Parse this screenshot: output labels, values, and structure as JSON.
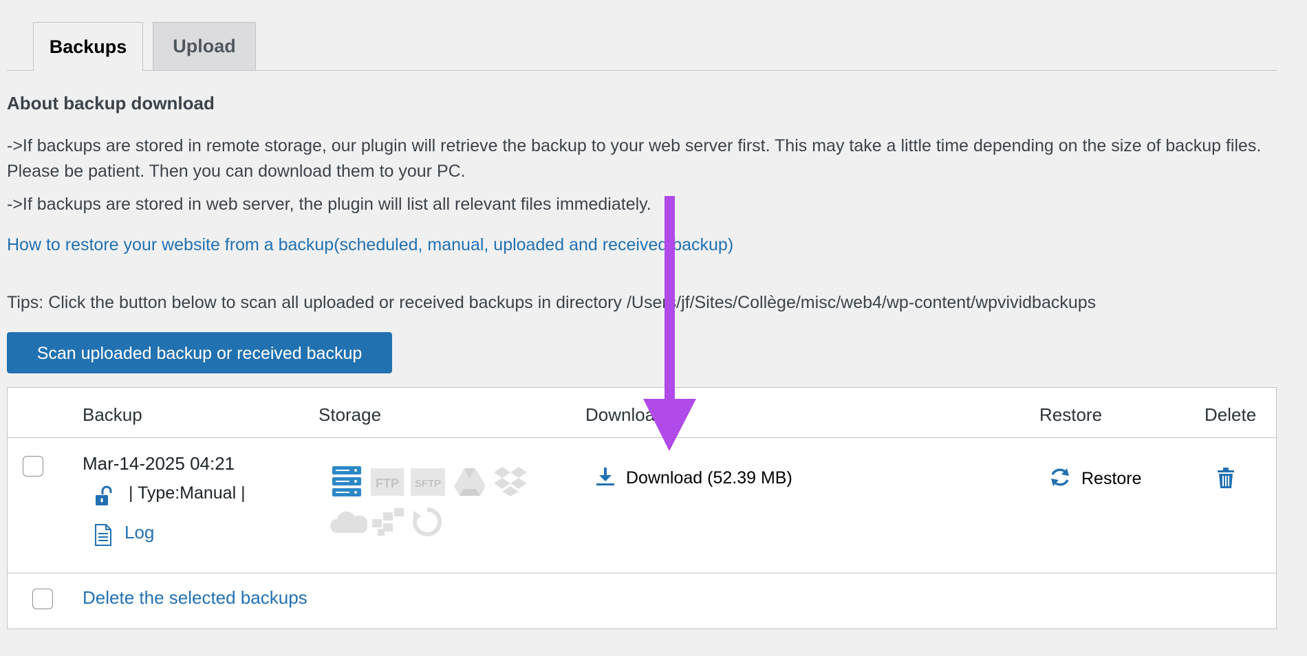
{
  "tabs": [
    {
      "label": "Backups",
      "active": true
    },
    {
      "label": "Upload",
      "active": false
    }
  ],
  "about": {
    "heading": "About backup download",
    "paragraph1": "->If backups are stored in remote storage, our plugin will retrieve the backup to your web server first. This may take a little time depending on the size of backup files. Please be patient. Then you can download them to your PC.",
    "paragraph2": "->If backups are stored in web server, the plugin will list all relevant files immediately.",
    "link": "How to restore your website from a backup(scheduled, manual, uploaded and received backup)"
  },
  "tips": "Tips: Click the button below to scan all uploaded or received backups in directory /Users/jf/Sites/Collège/misc/web4/wp-content/wpvividbackups",
  "scan_button": "Scan uploaded backup or received backup",
  "table": {
    "headers": {
      "backup": "Backup",
      "storage": "Storage",
      "download": "Download",
      "restore": "Restore",
      "delete": "Delete"
    },
    "row": {
      "date": "Mar-14-2025 04:21",
      "type": "| Type:Manual |",
      "log": "Log",
      "download": "Download (52.39 MB)",
      "restore": "Restore",
      "storage_icons": [
        "server-icon",
        "ftp-icon",
        "sftp-icon",
        "google-drive-icon",
        "dropbox-icon",
        "onedrive-icon",
        "s3-icon",
        "pcloud-icon"
      ]
    },
    "footer": {
      "delete_selected": "Delete the selected backups"
    }
  },
  "colors": {
    "link": "#2271b1",
    "button": "#2271b1",
    "arrow": "#b04ae8",
    "storage_active": "#2b88c7",
    "storage_inactive": "#d8d8d8"
  }
}
